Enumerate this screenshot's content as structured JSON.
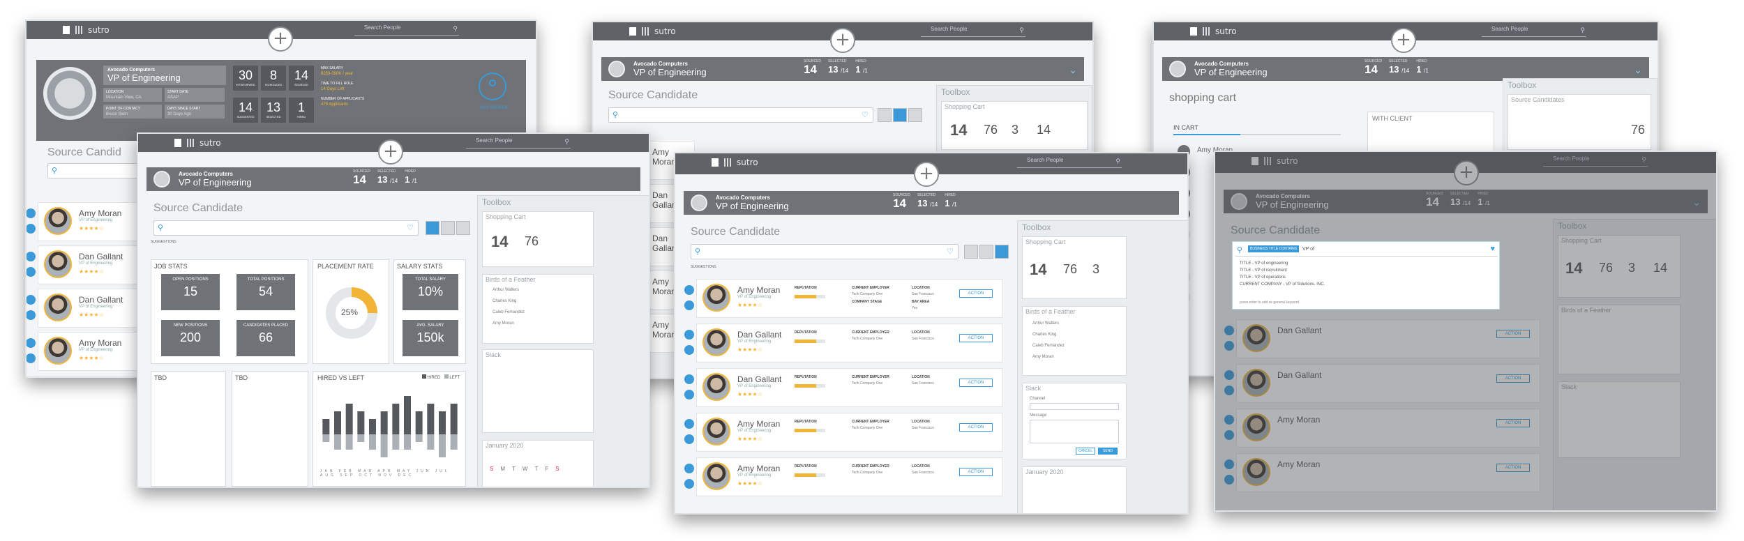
{
  "brand": "sutro",
  "search_people": "Search People",
  "job": {
    "company": "Avocado Computers",
    "title": "VP of Engineering"
  },
  "stats": {
    "hdr_label": "SOURCED",
    "hdr_value": "14",
    "sel_label": "SELECTED",
    "sel_value": "13",
    "sel_unit": "/14",
    "hired_label": "HIRED",
    "hired_value": "1",
    "hired_unit": "/1"
  },
  "profile": {
    "location_label": "LOCATION",
    "location": "Mountain View, CA",
    "start_label": "START DATE",
    "start": "ASAP",
    "contact_label": "POINT OF CONTACT",
    "contact": "Bruce Stein",
    "last_label": "DAYS SINCE START",
    "last": "30 Days Ago",
    "big": [
      {
        "v": "30",
        "l": "INTERVIEWED"
      },
      {
        "v": "8",
        "l": "SCHEDULED"
      },
      {
        "v": "14",
        "l": "SOURCED"
      },
      {
        "v": "14",
        "l": "SUGGESTED"
      },
      {
        "v": "13",
        "l": "SELECTED"
      },
      {
        "v": "1",
        "l": "HIRED"
      }
    ],
    "salary_label": "MAX SALARY",
    "salary": "$250-350K / year",
    "time_label": "TIME TO FILL ROLE",
    "time": "14 Days Left",
    "apps_label": "NUMBER OF APPLICANTS",
    "apps": "475 Applicants",
    "add_source": "ADD SOURCE"
  },
  "source_candidate": "Source Candidate",
  "source_candid_short": "Source Candid",
  "suggestions_label": "SUGGESTIONS",
  "candidates": [
    {
      "name": "Amy Moran",
      "role": "VP of Engineering"
    },
    {
      "name": "Dan Gallant",
      "role": "VP of Engineering"
    },
    {
      "name": "Dan Gallant",
      "role": "VP of Engineering"
    },
    {
      "name": "Amy Moran",
      "role": "VP of Engineering"
    },
    {
      "name": "Amy Moran",
      "role": "VP of Engineering"
    }
  ],
  "cols": {
    "reputation": "REPUTATION",
    "employer": "CURRENT EMPLOYER",
    "employer_v": "Tech Company One",
    "company_stage": "COMPANY STAGE",
    "location": "LOCATION",
    "location_v": "San Francisco",
    "bay": "BAY AREA",
    "bay_v": "Yes",
    "action": "ACTION"
  },
  "toolbox": "Toolbox",
  "shopping_cart": "Shopping Cart",
  "cart": {
    "in_cart": "14",
    "interviewing": "76",
    "to_be_sent": "3",
    "sent": "14"
  },
  "birds": "Birds of a Feather",
  "birds_list": [
    "Arthur Walters",
    "Charles King",
    "Caleb Fernandez",
    "Amy Moran"
  ],
  "slack": "Slack",
  "slack_channel": "Channel",
  "slack_message": "Message",
  "slack_send": "SEND",
  "slack_cancel": "CANCEL",
  "january": "January 2020",
  "weekdays": [
    "S",
    "M",
    "T",
    "W",
    "T",
    "F",
    "S"
  ],
  "shopping_cart_lower": "shopping cart",
  "in_cart_label": "IN CART",
  "with_client": "WITH CLIENT",
  "source_candidates": "Source Candidates",
  "stats_panel": {
    "job_stats": "JOB STATS",
    "open_label": "OPEN POSITIONS",
    "open": "15",
    "total_label": "TOTAL POSITIONS",
    "total": "54",
    "new_label": "NEW POSITIONS",
    "new": "200",
    "placed_label": "CANDIDATES PLACED",
    "placed": "66",
    "placement_rate": "PLACEMENT RATE",
    "rate": "25%",
    "salary_stats": "SALARY STATS",
    "total_salary_label": "TOTAL SALARY",
    "total_salary": "10%",
    "avg_salary_label": "AVG. SALARY",
    "avg_salary": "150k",
    "tbd": "TBD",
    "hired_vs_left": "HIRED VS LEFT",
    "hired_legend": "HIRED",
    "left_legend": "LEFT",
    "months": "JAN FEB MAR APR MAY JUN JUL AUG SEP OCT NOV DEC"
  },
  "keyword_menu": {
    "chip": "BUSINESS TITLE CONTAINS",
    "typed": "VP of",
    "items": [
      "TITLE - VP of engineering",
      "TITLE - VP of recruitment",
      "TITLE - VP of operations",
      "CURRENT COMPANY - VP of Solutions, INC."
    ],
    "hint": "press enter to add as general keyword"
  },
  "chart_data": {
    "type": "bar",
    "title": "HIRED VS LEFT",
    "categories": [
      "JAN",
      "FEB",
      "MAR",
      "APR",
      "MAY",
      "JUN",
      "JUL",
      "AUG",
      "SEP",
      "OCT",
      "NOV",
      "DEC"
    ],
    "series": [
      {
        "name": "HIRED",
        "values": [
          2,
          3,
          4,
          3,
          2,
          3,
          4,
          5,
          3,
          4,
          3,
          4
        ]
      },
      {
        "name": "LEFT",
        "values": [
          -1,
          -2,
          -2,
          -1,
          -2,
          -3,
          -2,
          -2,
          -1,
          -2,
          -3,
          -2
        ]
      }
    ],
    "ylim": [
      -4,
      6
    ],
    "grid": false,
    "legend": "top-right"
  }
}
